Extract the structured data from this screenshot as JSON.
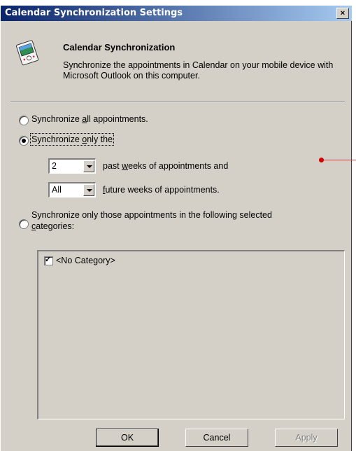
{
  "window": {
    "title": "Calendar Synchronization Settings",
    "close_glyph": "×"
  },
  "header": {
    "title": "Calendar Synchronization",
    "description": "Synchronize the appointments in Calendar on your mobile device with Microsoft Outlook on this computer."
  },
  "options": {
    "all": {
      "prefix": "Synchronize ",
      "accel": "a",
      "suffix": "ll appointments.",
      "selected": false
    },
    "only": {
      "prefix": "Synchronize ",
      "accel": "o",
      "suffix": "nly the",
      "selected": true
    },
    "categories": {
      "line1": "Synchronize only those appointments in the following selected",
      "accel": "c",
      "line2_rest": "ategories:",
      "selected": false
    }
  },
  "past_weeks": {
    "value": "2",
    "label_prefix": "past ",
    "accel": "w",
    "label_suffix": "eeks of appointments and"
  },
  "future_weeks": {
    "value": "All",
    "accel": "f",
    "label_suffix": "uture weeks of appointments."
  },
  "category_list": {
    "items": [
      {
        "label": "<No Category>",
        "checked": true
      }
    ]
  },
  "buttons": {
    "ok": "OK",
    "cancel": "Cancel",
    "apply": "Apply"
  },
  "colors": {
    "titlebar_start": "#0a246a",
    "titlebar_end": "#a6caf0",
    "dialog_bg": "#d4d0c8",
    "annotation_red": "#d40000"
  }
}
